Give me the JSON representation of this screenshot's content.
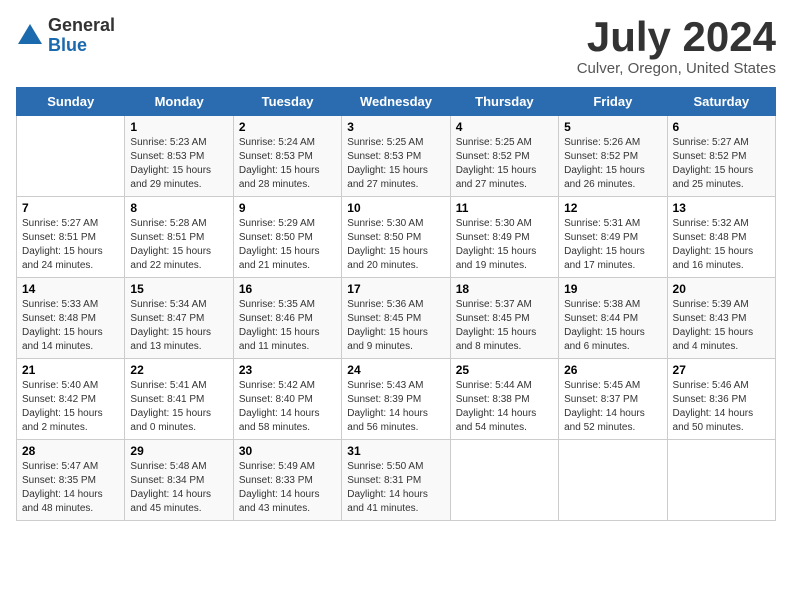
{
  "logo": {
    "general": "General",
    "blue": "Blue"
  },
  "title": "July 2024",
  "location": "Culver, Oregon, United States",
  "days_of_week": [
    "Sunday",
    "Monday",
    "Tuesday",
    "Wednesday",
    "Thursday",
    "Friday",
    "Saturday"
  ],
  "weeks": [
    [
      {
        "day": "",
        "info": ""
      },
      {
        "day": "1",
        "info": "Sunrise: 5:23 AM\nSunset: 8:53 PM\nDaylight: 15 hours\nand 29 minutes."
      },
      {
        "day": "2",
        "info": "Sunrise: 5:24 AM\nSunset: 8:53 PM\nDaylight: 15 hours\nand 28 minutes."
      },
      {
        "day": "3",
        "info": "Sunrise: 5:25 AM\nSunset: 8:53 PM\nDaylight: 15 hours\nand 27 minutes."
      },
      {
        "day": "4",
        "info": "Sunrise: 5:25 AM\nSunset: 8:52 PM\nDaylight: 15 hours\nand 27 minutes."
      },
      {
        "day": "5",
        "info": "Sunrise: 5:26 AM\nSunset: 8:52 PM\nDaylight: 15 hours\nand 26 minutes."
      },
      {
        "day": "6",
        "info": "Sunrise: 5:27 AM\nSunset: 8:52 PM\nDaylight: 15 hours\nand 25 minutes."
      }
    ],
    [
      {
        "day": "7",
        "info": "Sunrise: 5:27 AM\nSunset: 8:51 PM\nDaylight: 15 hours\nand 24 minutes."
      },
      {
        "day": "8",
        "info": "Sunrise: 5:28 AM\nSunset: 8:51 PM\nDaylight: 15 hours\nand 22 minutes."
      },
      {
        "day": "9",
        "info": "Sunrise: 5:29 AM\nSunset: 8:50 PM\nDaylight: 15 hours\nand 21 minutes."
      },
      {
        "day": "10",
        "info": "Sunrise: 5:30 AM\nSunset: 8:50 PM\nDaylight: 15 hours\nand 20 minutes."
      },
      {
        "day": "11",
        "info": "Sunrise: 5:30 AM\nSunset: 8:49 PM\nDaylight: 15 hours\nand 19 minutes."
      },
      {
        "day": "12",
        "info": "Sunrise: 5:31 AM\nSunset: 8:49 PM\nDaylight: 15 hours\nand 17 minutes."
      },
      {
        "day": "13",
        "info": "Sunrise: 5:32 AM\nSunset: 8:48 PM\nDaylight: 15 hours\nand 16 minutes."
      }
    ],
    [
      {
        "day": "14",
        "info": "Sunrise: 5:33 AM\nSunset: 8:48 PM\nDaylight: 15 hours\nand 14 minutes."
      },
      {
        "day": "15",
        "info": "Sunrise: 5:34 AM\nSunset: 8:47 PM\nDaylight: 15 hours\nand 13 minutes."
      },
      {
        "day": "16",
        "info": "Sunrise: 5:35 AM\nSunset: 8:46 PM\nDaylight: 15 hours\nand 11 minutes."
      },
      {
        "day": "17",
        "info": "Sunrise: 5:36 AM\nSunset: 8:45 PM\nDaylight: 15 hours\nand 9 minutes."
      },
      {
        "day": "18",
        "info": "Sunrise: 5:37 AM\nSunset: 8:45 PM\nDaylight: 15 hours\nand 8 minutes."
      },
      {
        "day": "19",
        "info": "Sunrise: 5:38 AM\nSunset: 8:44 PM\nDaylight: 15 hours\nand 6 minutes."
      },
      {
        "day": "20",
        "info": "Sunrise: 5:39 AM\nSunset: 8:43 PM\nDaylight: 15 hours\nand 4 minutes."
      }
    ],
    [
      {
        "day": "21",
        "info": "Sunrise: 5:40 AM\nSunset: 8:42 PM\nDaylight: 15 hours\nand 2 minutes."
      },
      {
        "day": "22",
        "info": "Sunrise: 5:41 AM\nSunset: 8:41 PM\nDaylight: 15 hours\nand 0 minutes."
      },
      {
        "day": "23",
        "info": "Sunrise: 5:42 AM\nSunset: 8:40 PM\nDaylight: 14 hours\nand 58 minutes."
      },
      {
        "day": "24",
        "info": "Sunrise: 5:43 AM\nSunset: 8:39 PM\nDaylight: 14 hours\nand 56 minutes."
      },
      {
        "day": "25",
        "info": "Sunrise: 5:44 AM\nSunset: 8:38 PM\nDaylight: 14 hours\nand 54 minutes."
      },
      {
        "day": "26",
        "info": "Sunrise: 5:45 AM\nSunset: 8:37 PM\nDaylight: 14 hours\nand 52 minutes."
      },
      {
        "day": "27",
        "info": "Sunrise: 5:46 AM\nSunset: 8:36 PM\nDaylight: 14 hours\nand 50 minutes."
      }
    ],
    [
      {
        "day": "28",
        "info": "Sunrise: 5:47 AM\nSunset: 8:35 PM\nDaylight: 14 hours\nand 48 minutes."
      },
      {
        "day": "29",
        "info": "Sunrise: 5:48 AM\nSunset: 8:34 PM\nDaylight: 14 hours\nand 45 minutes."
      },
      {
        "day": "30",
        "info": "Sunrise: 5:49 AM\nSunset: 8:33 PM\nDaylight: 14 hours\nand 43 minutes."
      },
      {
        "day": "31",
        "info": "Sunrise: 5:50 AM\nSunset: 8:31 PM\nDaylight: 14 hours\nand 41 minutes."
      },
      {
        "day": "",
        "info": ""
      },
      {
        "day": "",
        "info": ""
      },
      {
        "day": "",
        "info": ""
      }
    ]
  ]
}
